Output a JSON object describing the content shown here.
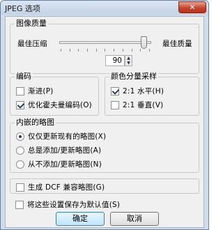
{
  "window": {
    "title": "JPEG 选项",
    "close_glyph": "✕"
  },
  "image_quality": {
    "group_label": "图像质量",
    "min_label": "最佳压缩",
    "max_label": "最佳质量",
    "value": "90",
    "slider_fraction": 0.92
  },
  "encoding": {
    "group_label": "编码",
    "progressive": {
      "label": "渐进(P)",
      "checked": false
    },
    "optimize_huffman": {
      "label": "优化霍夫曼编码(O)",
      "checked": true
    }
  },
  "chroma_subsampling": {
    "group_label": "颜色分量采样",
    "horizontal": {
      "label": "2:1 水平(H)",
      "checked": true
    },
    "vertical": {
      "label": "2:1 垂直(V)",
      "checked": false
    }
  },
  "thumbnail": {
    "group_label": "内嵌的略图",
    "options": [
      {
        "label": "仅仅更新现有的略图(X)",
        "selected": true
      },
      {
        "label": "总是添加/更新略图(A)",
        "selected": false
      },
      {
        "label": "从不添加/更新略图(N)",
        "selected": false
      }
    ]
  },
  "dcf_thumbnail": {
    "label": "生成 DCF 兼容略图(G)",
    "checked": false
  },
  "save_default": {
    "label": "将这些设置保存为默认值(S)",
    "checked": false
  },
  "buttons": {
    "ok": "确定",
    "cancel": "取消"
  }
}
